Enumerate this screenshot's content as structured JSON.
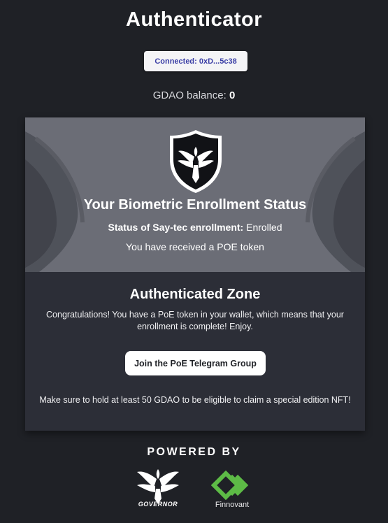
{
  "header": {
    "title": "Authenticator",
    "connect_label": "Connected: 0xD...5c38",
    "balance_label": "GDAO balance:",
    "balance_value": "0"
  },
  "status": {
    "title": "Your Biometric Enrollment Status",
    "enrollment_label": "Status of Say-tec enrollment:",
    "enrollment_value": "Enrolled",
    "poe_message": "You have received a POE token"
  },
  "zone": {
    "title": "Authenticated Zone",
    "message": "Congratulations! You have a PoE token in your wallet, which means that your enrollment is complete! Enjoy.",
    "telegram_button": "Join the PoE Telegram Group",
    "hold_message": "Make sure to hold at least 50 GDAO to be eligible to claim a special edition NFT!"
  },
  "footer": {
    "powered_by": "POWERED BY",
    "partners": [
      {
        "name": "GOVERNOR",
        "icon": "governor-phoenix-logo"
      },
      {
        "name": "Finnovant",
        "icon": "finnovant-chevron-logo"
      }
    ]
  },
  "colors": {
    "background": "#1f2126",
    "card": "#2c2e37",
    "status_panel": "#6b6d76",
    "connect_text": "#3b3fa6",
    "finnovant_green": "#5dbb46"
  }
}
